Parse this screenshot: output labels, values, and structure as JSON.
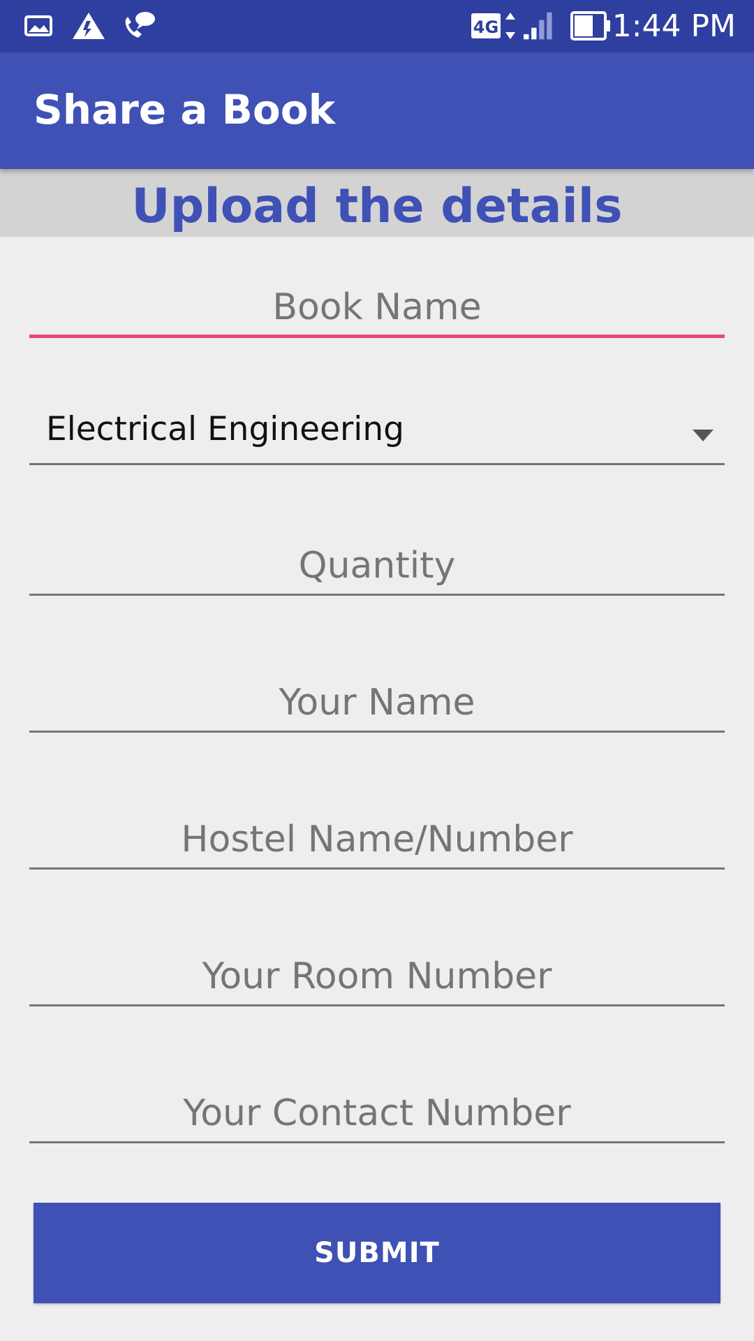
{
  "status_bar": {
    "time": "1:44 PM",
    "network": "4G",
    "icons": [
      "photo-icon",
      "drive-icon",
      "wifi-calling-icon",
      "network-4g-icon",
      "signal-icon",
      "battery-icon"
    ]
  },
  "app_bar": {
    "title": "Share a Book"
  },
  "heading": "Upload the details",
  "form": {
    "book_name_placeholder": "Book Name",
    "department_selected": "Electrical Engineering",
    "quantity_placeholder": "Quantity",
    "your_name_placeholder": "Your Name",
    "hostel_placeholder": "Hostel Name/Number",
    "room_placeholder": "Your Room Number",
    "contact_placeholder": "Your Contact Number",
    "submit_label": "SUBMIT"
  },
  "colors": {
    "primary": "#3f51b5",
    "primary_dark": "#2f3f9f",
    "accent": "#e8457e",
    "background": "#eeeeee",
    "heading_band": "#d3d3d3"
  }
}
